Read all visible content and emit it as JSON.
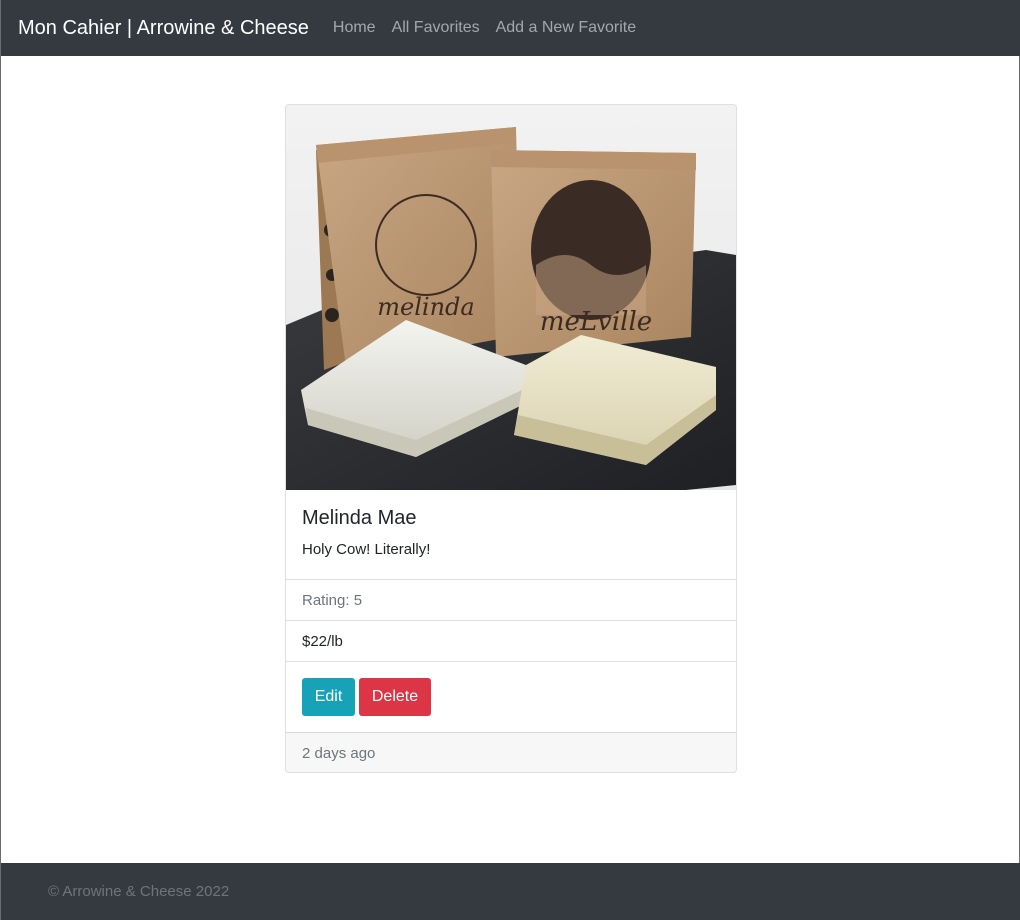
{
  "navbar": {
    "brand": "Mon Cahier | Arrowine & Cheese",
    "links": [
      "Home",
      "All Favorites",
      "Add a New Favorite"
    ]
  },
  "card": {
    "image_alt": "Melinda Mae and Melville cheeses with boxes",
    "title": "Melinda Mae",
    "description": "Holy Cow! Literally!",
    "rating": "Rating: 5",
    "price": "$22/lb",
    "edit_label": "Edit",
    "delete_label": "Delete",
    "timestamp": "2 days ago"
  },
  "footer": {
    "text": "© Arrowine & Cheese 2022"
  },
  "colors": {
    "navbar": "#343a40",
    "edit_button": "#17a2b8",
    "delete_button": "#dc3545"
  }
}
